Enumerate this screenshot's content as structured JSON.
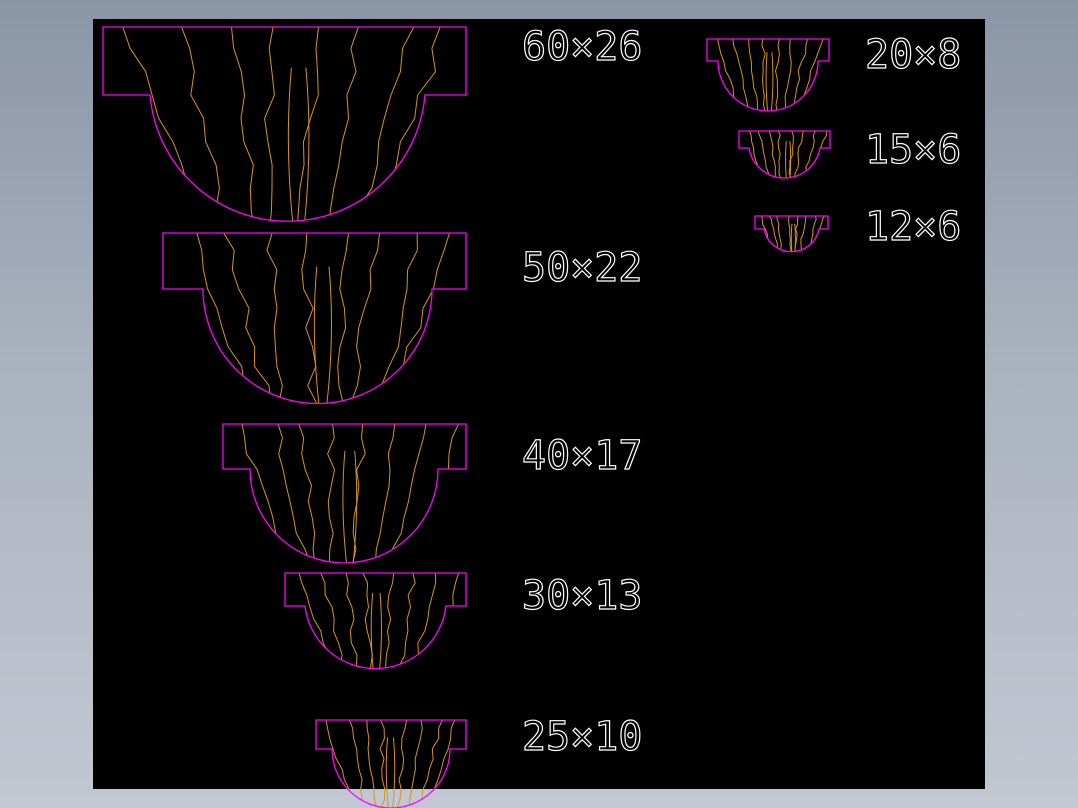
{
  "colors": {
    "background_top": "#8a95a6",
    "background_bottom": "#c2c8d2",
    "canvas": "#000000",
    "outline": "#ff00ff",
    "grain": "#d9931a",
    "label": "#ffffff"
  },
  "profiles": [
    {
      "id": "60x26",
      "label": "60×26"
    },
    {
      "id": "50x22",
      "label": "50×22"
    },
    {
      "id": "40x17",
      "label": "40×17"
    },
    {
      "id": "30x13",
      "label": "30×13"
    },
    {
      "id": "25x10",
      "label": "25×10"
    },
    {
      "id": "20x8",
      "label": "20×8"
    },
    {
      "id": "15x6",
      "label": "15×6"
    },
    {
      "id": "12x6",
      "label": "12×6"
    }
  ]
}
